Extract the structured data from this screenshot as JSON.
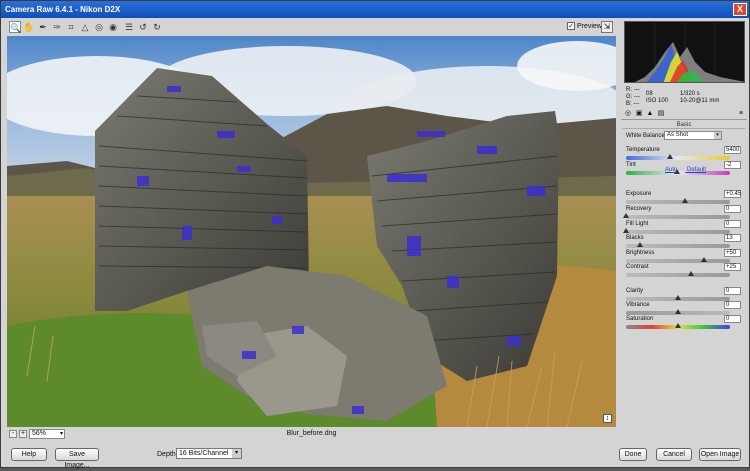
{
  "window": {
    "title": "Camera Raw 6.4.1  -  Nikon D2X",
    "close_label": "X"
  },
  "toolbar": {
    "tools": [
      {
        "icon": "zoom-icon",
        "glyph": "🔍"
      },
      {
        "icon": "hand-icon",
        "glyph": "✋"
      },
      {
        "icon": "white-balance-icon",
        "glyph": "✎"
      },
      {
        "icon": "color-sampler-icon",
        "glyph": "✎"
      },
      {
        "icon": "crop-icon",
        "glyph": "⌗"
      },
      {
        "icon": "straighten-icon",
        "glyph": "△"
      },
      {
        "icon": "spot-removal-icon",
        "glyph": "◎"
      },
      {
        "icon": "red-eye-icon",
        "glyph": "◉"
      },
      {
        "icon": "preferences-icon",
        "glyph": "☰"
      },
      {
        "icon": "rotate-left-icon",
        "glyph": "↺"
      },
      {
        "icon": "rotate-right-icon",
        "glyph": "↻"
      }
    ],
    "preview_label": "Preview",
    "preview_checked": true
  },
  "status": {
    "zoom": "56%",
    "filename": "Blur_before.dng",
    "zoom_out": "-",
    "zoom_in": "+"
  },
  "info": {
    "r": "R:",
    "g": "G:",
    "b": "B:",
    "dashes": "---",
    "aperture": "f/8",
    "shutter": "1/320 s",
    "iso": "ISO 100",
    "lens": "10-20@11 mm"
  },
  "panel": {
    "title": "Basic",
    "white_balance_label": "White Balance:",
    "white_balance_value": "As Shot",
    "auto": "Auto",
    "default": "Default",
    "sliders": [
      {
        "label": "Temperature",
        "value": "5400",
        "pos": 0.42
      },
      {
        "label": "Tint",
        "value": "-2",
        "pos": 0.49
      },
      {
        "label": "Exposure",
        "value": "+0.45",
        "pos": 0.56
      },
      {
        "label": "Recovery",
        "value": "0",
        "pos": 0.0
      },
      {
        "label": "Fill Light",
        "value": "0",
        "pos": 0.0
      },
      {
        "label": "Blacks",
        "value": "13",
        "pos": 0.13
      },
      {
        "label": "Brightness",
        "value": "+50",
        "pos": 0.75
      },
      {
        "label": "Contrast",
        "value": "+25",
        "pos": 0.62
      },
      {
        "label": "Clarity",
        "value": "0",
        "pos": 0.5
      },
      {
        "label": "Vibrance",
        "value": "0",
        "pos": 0.5
      },
      {
        "label": "Saturation",
        "value": "0",
        "pos": 0.5
      }
    ]
  },
  "footer": {
    "help": "Help",
    "save": "Save Image...",
    "depth_label": "Depth:",
    "depth_value": "16 Bits/Channel",
    "done": "Done",
    "cancel": "Cancel",
    "open": "Open Image"
  }
}
